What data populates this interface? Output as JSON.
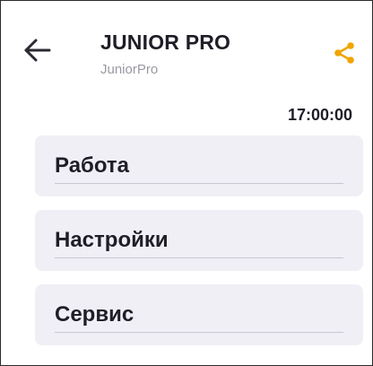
{
  "header": {
    "title": "JUNIOR PRO",
    "subtitle": "JuniorPro",
    "back_icon": "arrow-left-icon",
    "share_icon": "share-icon",
    "accent_color": "#f0a500"
  },
  "time": "17:00:00",
  "menu": {
    "items": [
      {
        "label": "Работа"
      },
      {
        "label": "Настройки"
      },
      {
        "label": "Сервис"
      }
    ]
  }
}
